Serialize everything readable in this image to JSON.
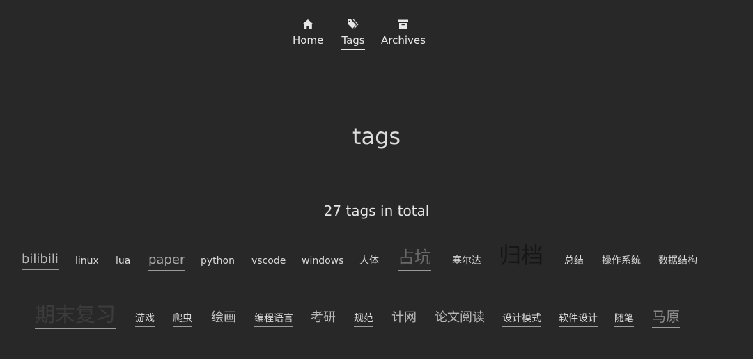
{
  "nav": {
    "items": [
      {
        "label": "Home",
        "icon": "home-icon"
      },
      {
        "label": "Tags",
        "icon": "tags-icon"
      },
      {
        "label": "Archives",
        "icon": "archive-icon"
      }
    ],
    "active": "Tags"
  },
  "page": {
    "title": "tags",
    "count_text": "27 tags in total"
  },
  "tags": [
    {
      "label": "bilibili",
      "color": "#b8b8b8"
    },
    {
      "label": "linux",
      "color": "#d8d8d8"
    },
    {
      "label": "lua",
      "color": "#d8d8d8"
    },
    {
      "label": "paper",
      "color": "#a8a8a8"
    },
    {
      "label": "python",
      "color": "#d8d8d8"
    },
    {
      "label": "vscode",
      "color": "#d8d8d8"
    },
    {
      "label": "windows",
      "color": "#d8d8d8"
    },
    {
      "label": "人体",
      "color": "#d8d8d8"
    },
    {
      "label": "占坑",
      "color": "#6a6a6a"
    },
    {
      "label": "塞尔达",
      "color": "#d8d8d8"
    },
    {
      "label": "归档",
      "color": "#161616"
    },
    {
      "label": "总结",
      "color": "#d8d8d8"
    },
    {
      "label": "操作系统",
      "color": "#d8d8d8"
    },
    {
      "label": "数据结构",
      "color": "#d8d8d8"
    },
    {
      "label": "期末复习",
      "color": "#3c3c3c"
    },
    {
      "label": "游戏",
      "color": "#d8d8d8"
    },
    {
      "label": "爬虫",
      "color": "#d8d8d8"
    },
    {
      "label": "绘画",
      "color": "#c4c4c4"
    },
    {
      "label": "编程语言",
      "color": "#d8d8d8"
    },
    {
      "label": "考研",
      "color": "#b8b8b8"
    },
    {
      "label": "规范",
      "color": "#d8d8d8"
    },
    {
      "label": "计网",
      "color": "#b8b8b8"
    },
    {
      "label": "论文阅读",
      "color": "#b8b8b8"
    },
    {
      "label": "设计模式",
      "color": "#d8d8d8"
    },
    {
      "label": "软件设计",
      "color": "#d8d8d8"
    },
    {
      "label": "随笔",
      "color": "#d8d8d8"
    },
    {
      "label": "马原",
      "color": "#8a8a8a"
    }
  ]
}
